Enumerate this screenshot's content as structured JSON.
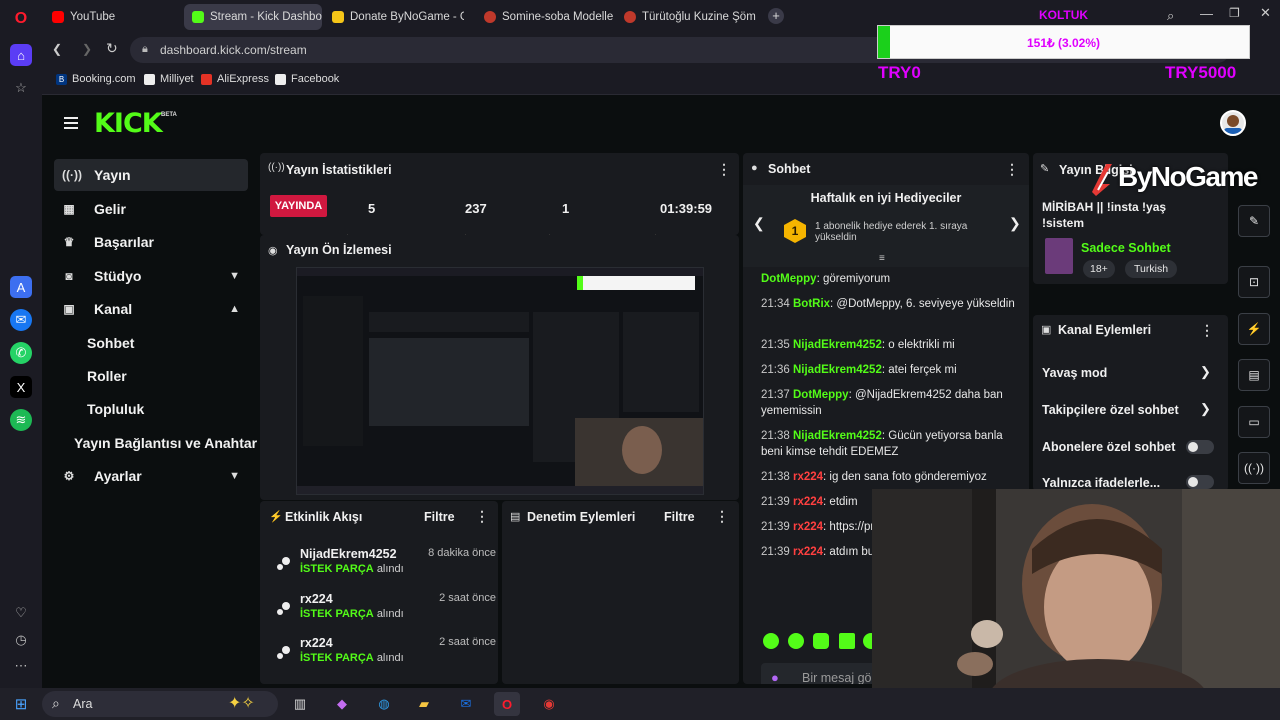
{
  "browser": {
    "tabs": [
      {
        "label": "YouTube"
      },
      {
        "label": "Stream - Kick Dashboard"
      },
      {
        "label": "Donate ByNoGame - Gele"
      },
      {
        "label": "Somine-soba Modelleri, F"
      },
      {
        "label": "Türütoğlu Kuzine Şömine"
      }
    ],
    "address": "dashboard.kick.com/stream",
    "bookmarks": [
      {
        "label": "Booking.com"
      },
      {
        "label": "Milliyet"
      },
      {
        "label": "AliExpress"
      },
      {
        "label": "Facebook"
      }
    ]
  },
  "donation_overlay": {
    "title": "KOLTUK",
    "progress_text": "151₺ (3.02%)",
    "progress_fraction": 0.0302,
    "min_label": "TRY0",
    "max_label": "TRY5000"
  },
  "brand_overlay": "ByNoGame",
  "kick": {
    "logo": "KICK",
    "logo_badge": "BETA",
    "nav": [
      {
        "label": "Yayın",
        "icon": "broadcast-icon"
      },
      {
        "label": "Gelir",
        "icon": "chart-icon"
      },
      {
        "label": "Başarılar",
        "icon": "trophy-icon"
      },
      {
        "label": "Stüdyo",
        "icon": "studio-icon"
      },
      {
        "label": "Kanal",
        "icon": "channel-icon"
      }
    ],
    "channel_sub": [
      "Sohbet",
      "Roller",
      "Topluluk"
    ],
    "nav_connection": "Yayın Bağlantısı ve Anahtar",
    "nav_settings": "Ayarlar",
    "stats": {
      "title": "Yayın İstatistikleri",
      "live_badge": "YAYINDA",
      "values": [
        "5",
        "237",
        "1",
        "01:39:59"
      ]
    },
    "preview_title": "Yayın Ön İzlemesi",
    "activity": {
      "title": "Etkinlik Akışı",
      "filter": "Filtre",
      "items": [
        {
          "name": "NijadEkrem4252",
          "ago": "8 dakika önce",
          "tag": "İSTEK PARÇA",
          "suffix": "alındı"
        },
        {
          "name": "rx224",
          "ago": "2 saat önce",
          "tag": "İSTEK PARÇA",
          "suffix": "alındı"
        },
        {
          "name": "rx224",
          "ago": "2 saat önce",
          "tag": "İSTEK PARÇA",
          "suffix": "alındı"
        }
      ]
    },
    "moderation": {
      "title": "Denetim Eylemleri",
      "filter": "Filtre"
    },
    "chat": {
      "title": "Sohbet",
      "gifters_title": "Haftalık en iyi Hediyeciler",
      "gifters_rank": "1",
      "gifters_text": "1 abonelik hediye ederek 1. sıraya yükseldin",
      "messages": [
        {
          "time": "",
          "user": "DotMeppy",
          "text": ": göremiyorum"
        },
        {
          "time": "21:34",
          "user": "BotRix",
          "text": ": @DotMeppy, 6. seviyeye yükseldin"
        },
        {
          "time": "21:35",
          "user": "NijadEkrem4252",
          "text": ": o elektrikli mi"
        },
        {
          "time": "21:36",
          "user": "NijadEkrem4252",
          "text": ": atei ferçek mi"
        },
        {
          "time": "21:37",
          "user": "DotMeppy",
          "text": ": @NijadEkrem4252 daha ban yememissin"
        },
        {
          "time": "21:38",
          "user": "NijadEkrem4252",
          "text": ": Gücün yetiyorsa banla beni kimse tehdit EDEMEZ"
        },
        {
          "time": "21:38",
          "user": "rx224",
          "text": ": ig den sana foto gönderemiyoz"
        },
        {
          "time": "21:39",
          "user": "rx224",
          "text": ": etdim"
        },
        {
          "time": "21:39",
          "user": "rx224",
          "text": ": https://pr"
        },
        {
          "time": "21:39",
          "user": "rx224",
          "text": ": atdım bu"
        }
      ],
      "input_placeholder": "Bir mesaj gö"
    },
    "stream_info": {
      "title": "Yayın Bilgisi",
      "stream_title": "MİRİBAH || !insta !yaş !sistem",
      "category": "Sadece Sohbet",
      "tags": [
        "18+",
        "Turkish"
      ]
    },
    "channel_actions": {
      "title": "Kanal Eylemleri",
      "items": [
        {
          "label": "Yavaş mod",
          "kind": "arrow"
        },
        {
          "label": "Takipçilere özel sohbet",
          "kind": "arrow"
        },
        {
          "label": "Abonelere özel sohbet",
          "kind": "toggle"
        },
        {
          "label": "Yalnızca ifadelerle...",
          "kind": "toggle"
        }
      ]
    }
  },
  "taskbar": {
    "search": "Ara"
  }
}
